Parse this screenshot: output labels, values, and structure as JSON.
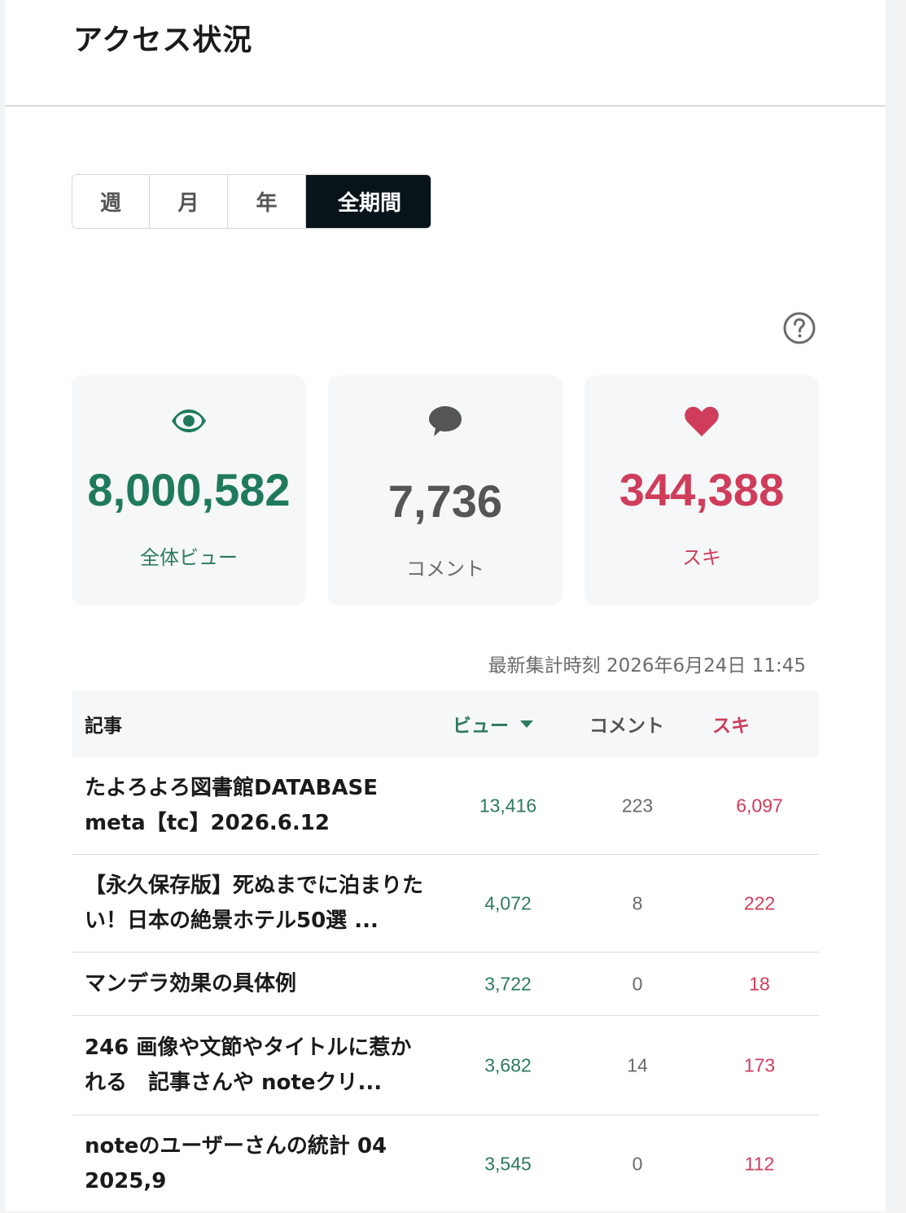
{
  "page": {
    "title": "アクセス状況"
  },
  "period_tabs": [
    {
      "label": "週",
      "active": false
    },
    {
      "label": "月",
      "active": false
    },
    {
      "label": "年",
      "active": false
    },
    {
      "label": "全期間",
      "active": true
    }
  ],
  "help_icon": "question-circle-icon",
  "stats": {
    "views": {
      "value": "8,000,582",
      "label": "全体ビュー",
      "icon": "eye-icon",
      "color": "#1f7a5c"
    },
    "comments": {
      "value": "7,736",
      "label": "コメント",
      "icon": "comment-bubble-icon",
      "color": "#555555"
    },
    "likes": {
      "value": "344,388",
      "label": "スキ",
      "icon": "heart-icon",
      "color": "#cf3d5b"
    }
  },
  "updated_at": "最新集計時刻 2026年6月24日 11:45",
  "table": {
    "headers": {
      "article": "記事",
      "views": "ビュー",
      "comments": "コメント",
      "likes": "スキ"
    },
    "rows": [
      {
        "title": "たよろよろ図書館DATABASE meta【tc】2026.6.12",
        "views": "13,416",
        "comments": "223",
        "likes": "6,097"
      },
      {
        "title": "【永久保存版】死ぬまでに泊まりたい！日本の絶景ホテル50選 ...",
        "views": "4,072",
        "comments": "8",
        "likes": "222"
      },
      {
        "title": "マンデラ効果の具体例",
        "views": "3,722",
        "comments": "0",
        "likes": "18"
      },
      {
        "title": "246 画像や文節やタイトルに惹かれる　記事さんや noteクリ...",
        "views": "3,682",
        "comments": "14",
        "likes": "173"
      },
      {
        "title": "noteのユーザーさんの統計 04 2025,9",
        "views": "3,545",
        "comments": "0",
        "likes": "112"
      }
    ]
  }
}
